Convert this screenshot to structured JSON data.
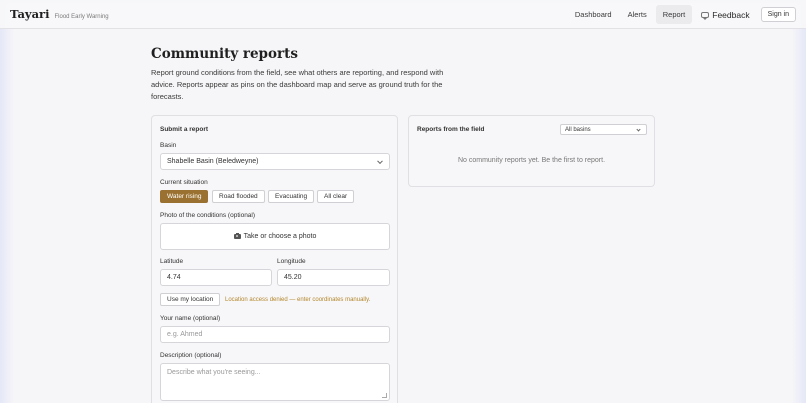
{
  "brand": {
    "name": "Tayari",
    "tagline": "Flood Early Warning"
  },
  "nav": {
    "items": [
      {
        "label": "Dashboard"
      },
      {
        "label": "Alerts"
      },
      {
        "label": "Report",
        "active": true
      }
    ],
    "feedback_label": "Feedback",
    "signin_label": "Sign in"
  },
  "page": {
    "title": "Community reports",
    "intro": "Report ground conditions from the field, see what others are reporting, and respond with advice. Reports appear as pins on the dashboard map and serve as ground truth for the forecasts."
  },
  "form": {
    "heading": "Submit a report",
    "basin_label": "Basin",
    "basin_value": "Shabelle Basin (Beledweyne)",
    "situation_label": "Current situation",
    "situations": [
      {
        "label": "Water rising",
        "active": true
      },
      {
        "label": "Road flooded",
        "active": false
      },
      {
        "label": "Evacuating",
        "active": false
      },
      {
        "label": "All clear",
        "active": false
      }
    ],
    "photo_label": "Photo of the conditions (optional)",
    "photo_button": "Take or choose a photo",
    "latitude_label": "Latitude",
    "latitude_value": "4.74",
    "longitude_label": "Longitude",
    "longitude_value": "45.20",
    "location_button": "Use my location",
    "location_warning": "Location access denied — enter coordinates manually.",
    "name_label": "Your name (optional)",
    "name_placeholder": "e.g. Ahmed",
    "description_label": "Description (optional)",
    "description_placeholder": "Describe what you're seeing..."
  },
  "reports": {
    "heading": "Reports from the field",
    "filter_value": "All basins",
    "empty_message": "No community reports yet. Be the first to report."
  },
  "colors": {
    "accent": "#9a7130",
    "warning": "#b3872c"
  }
}
